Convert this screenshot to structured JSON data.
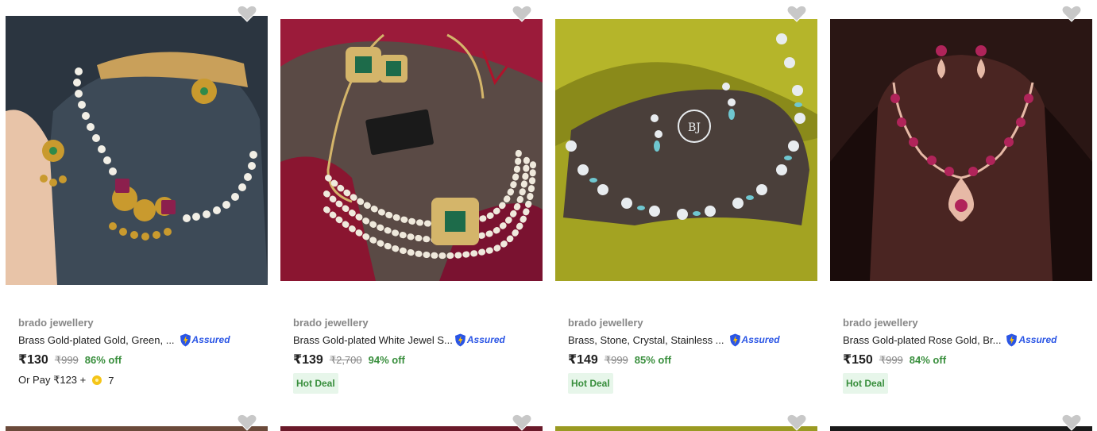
{
  "products": [
    {
      "brand": "brado jewellery",
      "title": "Brass Gold-plated Gold, Green, ...",
      "assured_label": "Assured",
      "price": "₹130",
      "mrp": "₹999",
      "discount": "86% off",
      "pay_text": "Or Pay ₹123 +",
      "pay_coins": "7",
      "image": "gold-pearl-necklace-with-earrings"
    },
    {
      "brand": "brado jewellery",
      "title": "Brass Gold-plated White Jewel S...",
      "assured_label": "Assured",
      "price": "₹139",
      "mrp": "₹2,700",
      "discount": "94% off",
      "tag": "Hot Deal",
      "image": "pearl-choker-with-emerald-set"
    },
    {
      "brand": "brado jewellery",
      "title": "Brass, Stone, Crystal, Stainless ...",
      "assured_label": "Assured",
      "price": "₹149",
      "mrp": "₹999",
      "discount": "85% off",
      "tag": "Hot Deal",
      "image": "silver-turquoise-necklace-set"
    },
    {
      "brand": "brado jewellery",
      "title": "Brass Gold-plated Rose Gold, Br...",
      "assured_label": "Assured",
      "price": "₹150",
      "mrp": "₹999",
      "discount": "84% off",
      "tag": "Hot Deal",
      "image": "rose-gold-pink-stone-necklace-set"
    }
  ],
  "icons": {
    "wishlist": "heart-icon",
    "assured": "assured-shield-icon",
    "coin": "supercoin-icon"
  },
  "colors": {
    "discount": "#388e3c",
    "assured": "#2a55e5",
    "tag_bg": "#e7f6ea",
    "muted": "#878787"
  }
}
